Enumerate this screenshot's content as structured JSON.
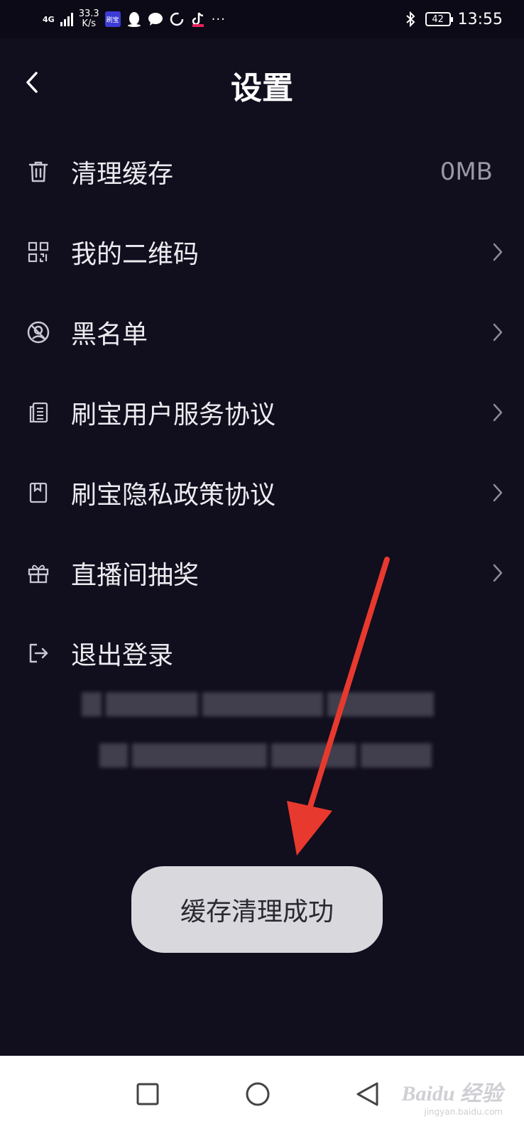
{
  "status_bar": {
    "network": "4G",
    "speed_value": "33.3",
    "speed_unit": "K/s",
    "app_badge": "刷宝",
    "battery": "42",
    "time": "13:55",
    "more": "···"
  },
  "header": {
    "title": "设置"
  },
  "settings": {
    "items": [
      {
        "label": "清理缓存",
        "value": "0MB",
        "icon": "trash-icon"
      },
      {
        "label": "我的二维码",
        "icon": "qr-code-icon"
      },
      {
        "label": "黑名单",
        "icon": "blocked-user-icon"
      },
      {
        "label": "刷宝用户服务协议",
        "icon": "document-icon"
      },
      {
        "label": "刷宝隐私政策协议",
        "icon": "book-icon"
      },
      {
        "label": "直播间抽奖",
        "icon": "gift-icon"
      },
      {
        "label": "退出登录",
        "icon": "logout-icon"
      }
    ]
  },
  "toast": {
    "message": "缓存清理成功"
  },
  "watermark": {
    "brand": "Baidu 经验",
    "url": "jingyan.baidu.com"
  },
  "colors": {
    "background": "#110e1e",
    "toast_bg": "#d9d8dd",
    "annotation_arrow": "#e8392f"
  }
}
